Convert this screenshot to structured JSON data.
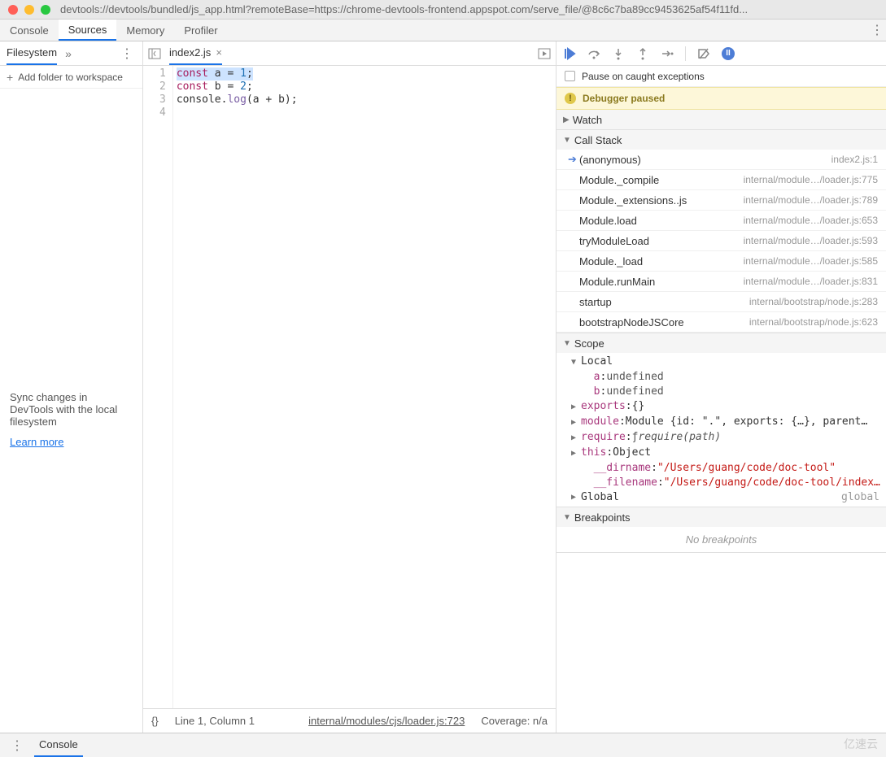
{
  "window": {
    "title": "devtools://devtools/bundled/js_app.html?remoteBase=https://chrome-devtools-frontend.appspot.com/serve_file/@8c6c7ba89cc9453625af54f11fd..."
  },
  "tabs": {
    "console": "Console",
    "sources": "Sources",
    "memory": "Memory",
    "profiler": "Profiler"
  },
  "filesystem": {
    "tab": "Filesystem",
    "addFolder": "Add folder to workspace",
    "message": "Sync changes in DevTools with the local filesystem",
    "learnMore": "Learn more"
  },
  "fileTab": {
    "name": "index2.js"
  },
  "code": {
    "lines": [
      "const a = 1;",
      "const b = 2;",
      "console.log(a + b);",
      ""
    ],
    "tokens": {
      "l1_kw": "const",
      "l1_a": "a",
      "l1_eq": "=",
      "l1_v": "1",
      "l1_sc": ";",
      "l2_kw": "const",
      "l2_b": "b",
      "l2_eq": "=",
      "l2_v": "2",
      "l2_sc": ";",
      "l3_obj": "console",
      "l3_dot": ".",
      "l3_fn": "log",
      "l3_op": "(",
      "l3_a": "a",
      "l3_pl": " + ",
      "l3_b": "b",
      "l3_cp": ")",
      "l3_sc": ";"
    }
  },
  "status": {
    "braces": "{}",
    "position": "Line 1, Column 1",
    "file": "internal/modules/cjs/loader.js:723",
    "coverage": "Coverage: n/a"
  },
  "debugger": {
    "pauseOnCaught": "Pause on caught exceptions",
    "paused": "Debugger paused",
    "sections": {
      "watch": "Watch",
      "callStack": "Call Stack",
      "scope": "Scope",
      "breakpoints": "Breakpoints"
    },
    "noBreakpoints": "No breakpoints",
    "callStack": [
      {
        "name": "(anonymous)",
        "loc": "index2.js:1",
        "top": true
      },
      {
        "name": "Module._compile",
        "loc": "internal/module…/loader.js:775"
      },
      {
        "name": "Module._extensions..js",
        "loc": "internal/module…/loader.js:789"
      },
      {
        "name": "Module.load",
        "loc": "internal/module…/loader.js:653"
      },
      {
        "name": "tryModuleLoad",
        "loc": "internal/module…/loader.js:593"
      },
      {
        "name": "Module._load",
        "loc": "internal/module…/loader.js:585"
      },
      {
        "name": "Module.runMain",
        "loc": "internal/module…/loader.js:831"
      },
      {
        "name": "startup",
        "loc": "internal/bootstrap/node.js:283"
      },
      {
        "name": "bootstrapNodeJSCore",
        "loc": "internal/bootstrap/node.js:623"
      }
    ],
    "scope": {
      "local": "Local",
      "a": {
        "k": "a",
        "v": "undefined"
      },
      "b": {
        "k": "b",
        "v": "undefined"
      },
      "exports": {
        "k": "exports",
        "v": "{}"
      },
      "module": {
        "k": "module",
        "v": "Module {id: \".\", exports: {…}, parent…"
      },
      "require": {
        "k": "require",
        "f": "ƒ",
        "v": "require(path)"
      },
      "this": {
        "k": "this",
        "v": "Object"
      },
      "dirname": {
        "k": "__dirname",
        "v": "\"/Users/guang/code/doc-tool\""
      },
      "filename": {
        "k": "__filename",
        "v": "\"/Users/guang/code/doc-tool/index…"
      },
      "global": {
        "k": "Global",
        "v": "global"
      }
    }
  },
  "drawer": {
    "console": "Console"
  },
  "watermark": "亿速云"
}
